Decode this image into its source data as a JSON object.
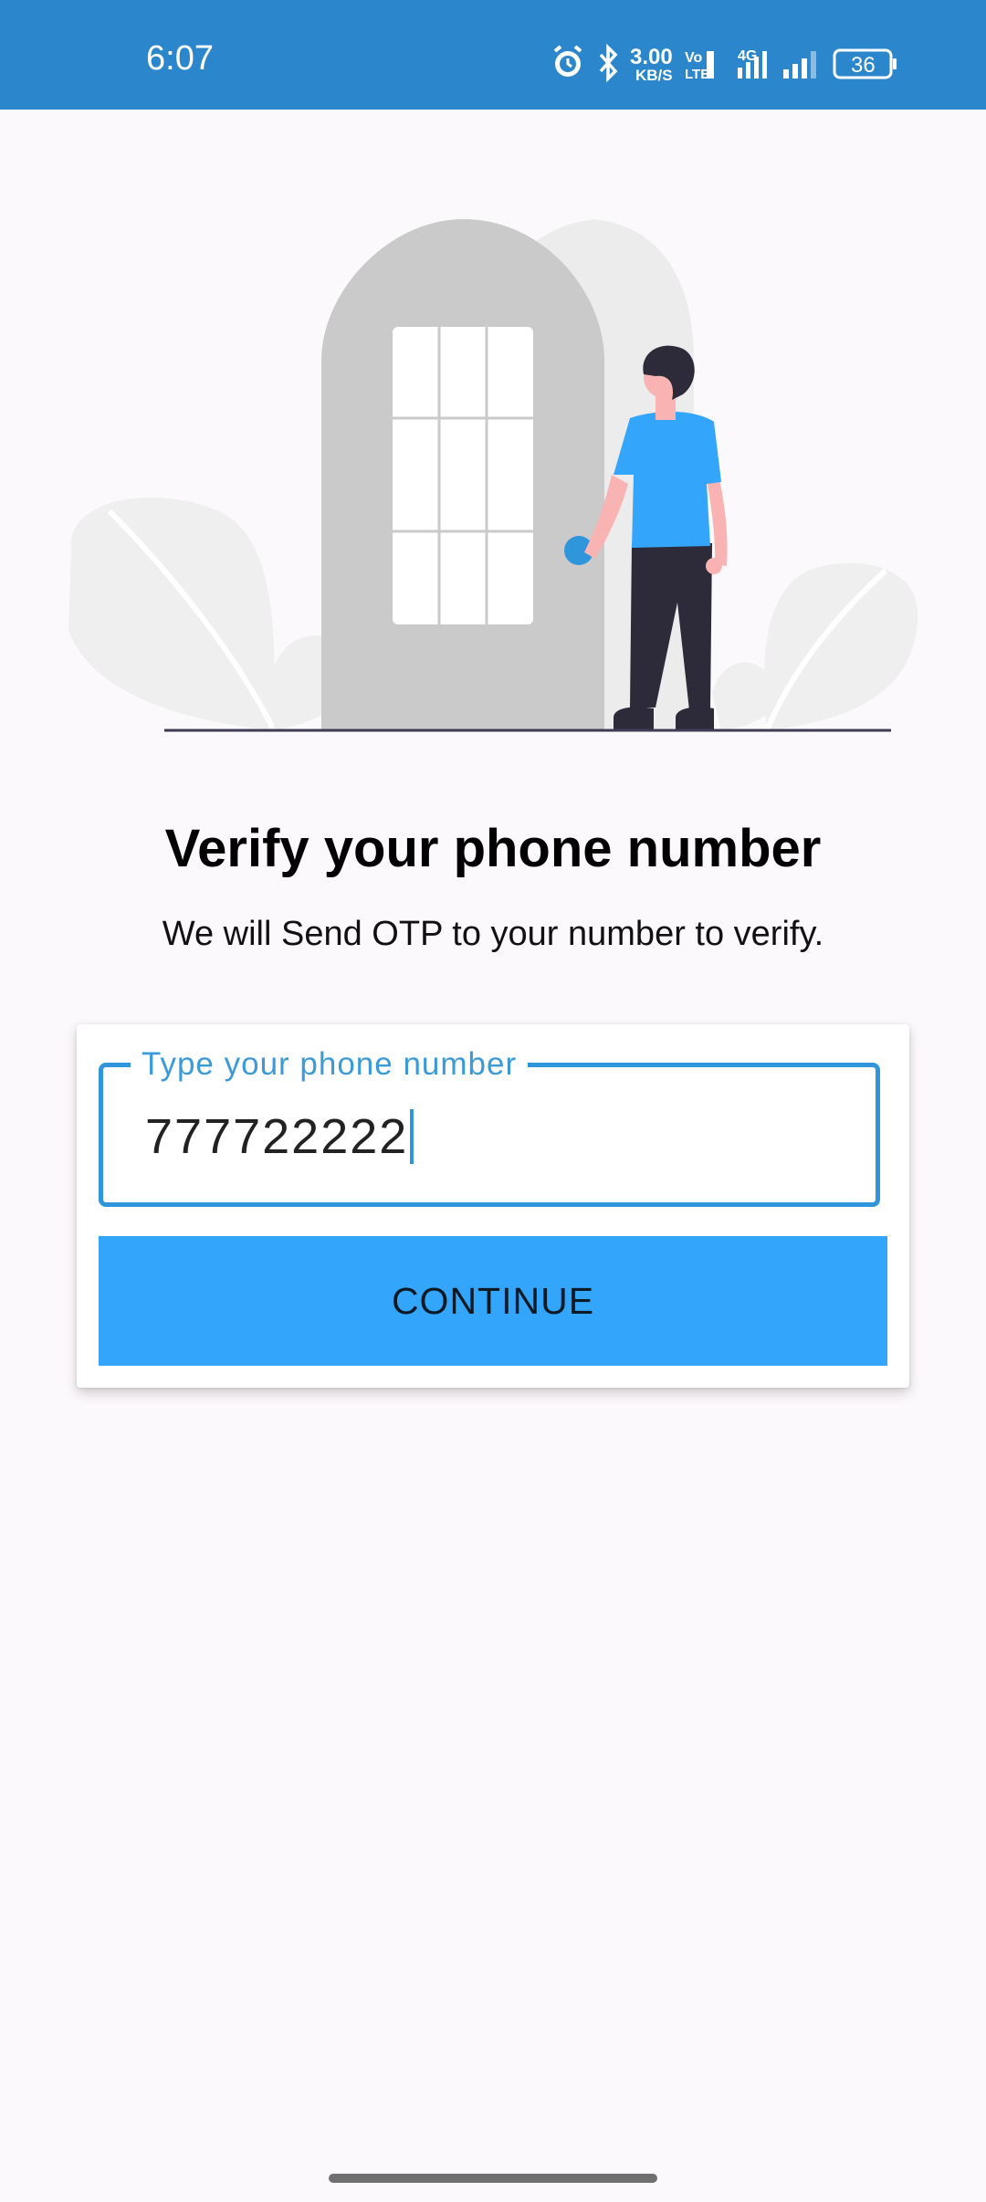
{
  "status_bar": {
    "time": "6:07",
    "net_speed_value": "3.00",
    "net_speed_unit": "KB/S",
    "volte_label": "Vo LTE",
    "network_type": "4G",
    "battery_level": "36",
    "background_color": "#2b86cb",
    "icons": [
      "alarm-icon",
      "bluetooth-icon",
      "signal-icon",
      "battery-icon"
    ]
  },
  "illustration": {
    "description_icon": "person-at-door-illustration",
    "accent_color": "#2f96db"
  },
  "main": {
    "title": "Verify your phone number",
    "subtitle": "We will Send OTP to your number to verify."
  },
  "form": {
    "phone_label": "Type your phone number",
    "phone_value": "777722222",
    "continue_label": "CONTINUE",
    "button_color": "#33a6fc"
  }
}
